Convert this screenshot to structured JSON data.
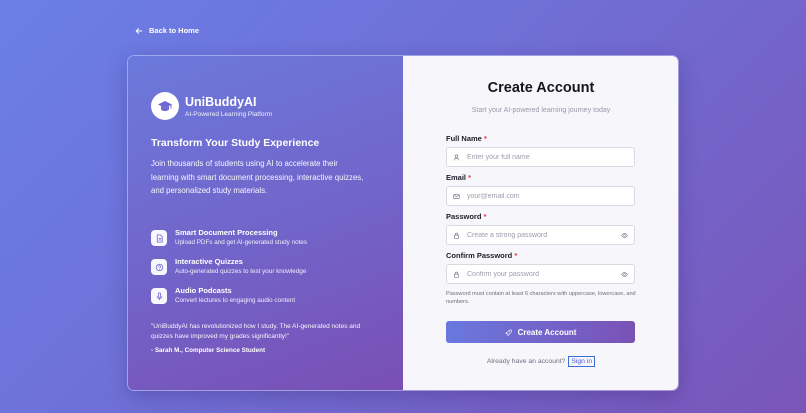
{
  "nav": {
    "back_label": "Back to Home"
  },
  "brand": {
    "name": "UniBuddyAI",
    "tagline": "AI-Powered Learning Platform",
    "logo_icon": "graduation-cap-icon"
  },
  "promo": {
    "heading": "Transform Your Study Experience",
    "description": "Join thousands of students using AI to accelerate their learning with smart document processing, interactive quizzes, and personalized study materials.",
    "features": [
      {
        "icon": "document-icon",
        "title": "Smart Document Processing",
        "desc": "Upload PDFs and get AI-generated study notes"
      },
      {
        "icon": "quiz-icon",
        "title": "Interactive Quizzes",
        "desc": "Auto-generated quizzes to test your knowledge"
      },
      {
        "icon": "microphone-icon",
        "title": "Audio Podcasts",
        "desc": "Convert lectures to engaging audio content"
      }
    ],
    "quote": "\"UniBuddyAI has revolutionized how I study. The AI-generated notes and quizzes have improved my grades significantly!\"",
    "quote_author": "- Sarah M., Computer Science Student"
  },
  "form": {
    "title": "Create Account",
    "subtitle": "Start your AI-powered learning journey today",
    "required_mark": "*",
    "fields": [
      {
        "label": "Full Name",
        "placeholder": "Enter your full name",
        "value": "",
        "icon": "user-icon"
      },
      {
        "label": "Email",
        "placeholder": "your@email.com",
        "value": "",
        "icon": "mail-icon"
      },
      {
        "label": "Password",
        "placeholder": "Create a strong password",
        "value": "",
        "icon": "lock-icon"
      },
      {
        "label": "Confirm Password",
        "placeholder": "Confirm your password",
        "value": "",
        "icon": "lock-icon"
      }
    ],
    "password_hint": "Password must contain at least 6 characters with uppercase, lowercase, and numbers.",
    "submit_label": "Create Account",
    "signin_prompt": "Already have an account?",
    "signin_label": "Sign in"
  },
  "colors": {
    "accent_start": "#6a78de",
    "accent_end": "#7a52b6",
    "required": "#e03a3a",
    "link": "#4a59d8"
  }
}
